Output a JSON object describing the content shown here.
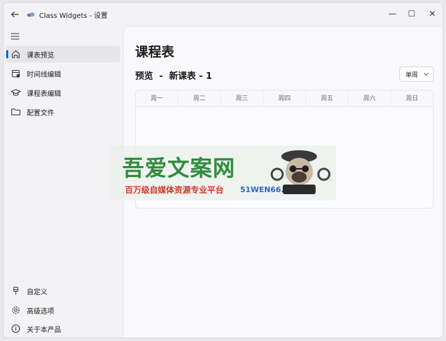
{
  "titlebar": {
    "title": "Class Widgets - 设置",
    "back_icon": "arrow-left-icon",
    "app_icon": "cloud-icon",
    "minimize": "—",
    "maximize": "☐",
    "close": "✕"
  },
  "sidebar": {
    "menu_icon": "hamburger-menu-icon",
    "top_items": [
      {
        "label": "课表预览",
        "icon": "home-icon",
        "active": true
      },
      {
        "label": "时间线编辑",
        "icon": "calendar-edit-icon"
      },
      {
        "label": "课程表编辑",
        "icon": "graduation-cap-icon"
      },
      {
        "label": "配置文件",
        "icon": "folder-icon"
      }
    ],
    "bottom_items": [
      {
        "label": "自定义",
        "icon": "brush-icon"
      },
      {
        "label": "高级选项",
        "icon": "gear-icon"
      },
      {
        "label": "关于本产品",
        "icon": "info-icon"
      }
    ]
  },
  "main": {
    "page_title": "课程表",
    "preview_title": "预览  -  新课表 - 1",
    "week_select": {
      "value": "单周"
    },
    "timetable": {
      "columns": [
        "周一",
        "周二",
        "周三",
        "周四",
        "周五",
        "周六",
        "周日"
      ]
    }
  },
  "watermark": {
    "title": "吾爱文案网",
    "subtitle": "百万级自媒体资源专业平台",
    "url": "51WEN66.COM"
  },
  "colors": {
    "accent": "#0067c0",
    "watermark_green": "#2f8d3c",
    "watermark_red": "#d13b2b"
  }
}
